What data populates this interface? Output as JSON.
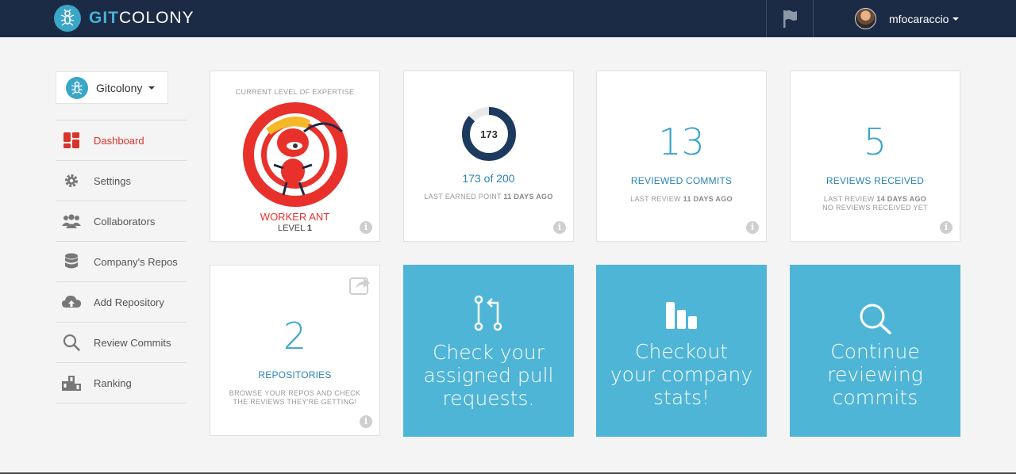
{
  "header": {
    "logo_git": "GIT",
    "logo_colony": "COLONY",
    "username": "mfocaraccio"
  },
  "sidebar": {
    "org_name": "Gitcolony",
    "items": [
      {
        "label": "Dashboard",
        "icon": "grid-icon",
        "active": true
      },
      {
        "label": "Settings",
        "icon": "gear-icon"
      },
      {
        "label": "Collaborators",
        "icon": "users-icon"
      },
      {
        "label": "Company's Repos",
        "icon": "database-icon"
      },
      {
        "label": "Add Repository",
        "icon": "cloud-upload-icon"
      },
      {
        "label": "Review Commits",
        "icon": "search-icon"
      },
      {
        "label": "Ranking",
        "icon": "podium-icon"
      }
    ]
  },
  "cards": {
    "expertise": {
      "heading": "CURRENT LEVEL OF EXPERTISE",
      "level_name": "WORKER ANT",
      "level_prefix": "LEVEL",
      "level_number": "1"
    },
    "points": {
      "center_value": "173",
      "summary": "173 of 200",
      "progress_fraction": 0.865,
      "caption_prefix": "LAST EARNED POINT",
      "caption_bold": "11 DAYS AGO"
    },
    "reviewed_commits": {
      "value": "13",
      "title": "REVIEWED COMMITS",
      "caption_prefix": "LAST REVIEW",
      "caption_bold": "11 DAYS AGO"
    },
    "reviews_received": {
      "value": "5",
      "title": "REVIEWS RECEIVED",
      "caption_prefix": "LAST REVIEW",
      "caption_bold": "14 DAYS AGO",
      "caption_line2": "NO REVIEWS RECEIVED YET"
    },
    "repositories": {
      "value": "2",
      "title": "REPOSITORIES",
      "caption_line1": "BROWSE YOUR REPOS AND CHECK",
      "caption_line2": "THE REVIEWS THEY'RE GETTING!"
    },
    "cta_pull_requests": {
      "lines": [
        "Check your",
        "assigned pull",
        "requests."
      ]
    },
    "cta_stats": {
      "lines": [
        "Checkout",
        "your company",
        "stats!"
      ]
    },
    "cta_review": {
      "lines": [
        "Continue",
        "reviewing",
        "commits"
      ]
    }
  },
  "info_glyph": "i",
  "colors": {
    "topbar": "#1c2b45",
    "accent_blue": "#4fb5d6",
    "active_red": "#d9342b",
    "ring_dark": "#1c3a5e"
  }
}
